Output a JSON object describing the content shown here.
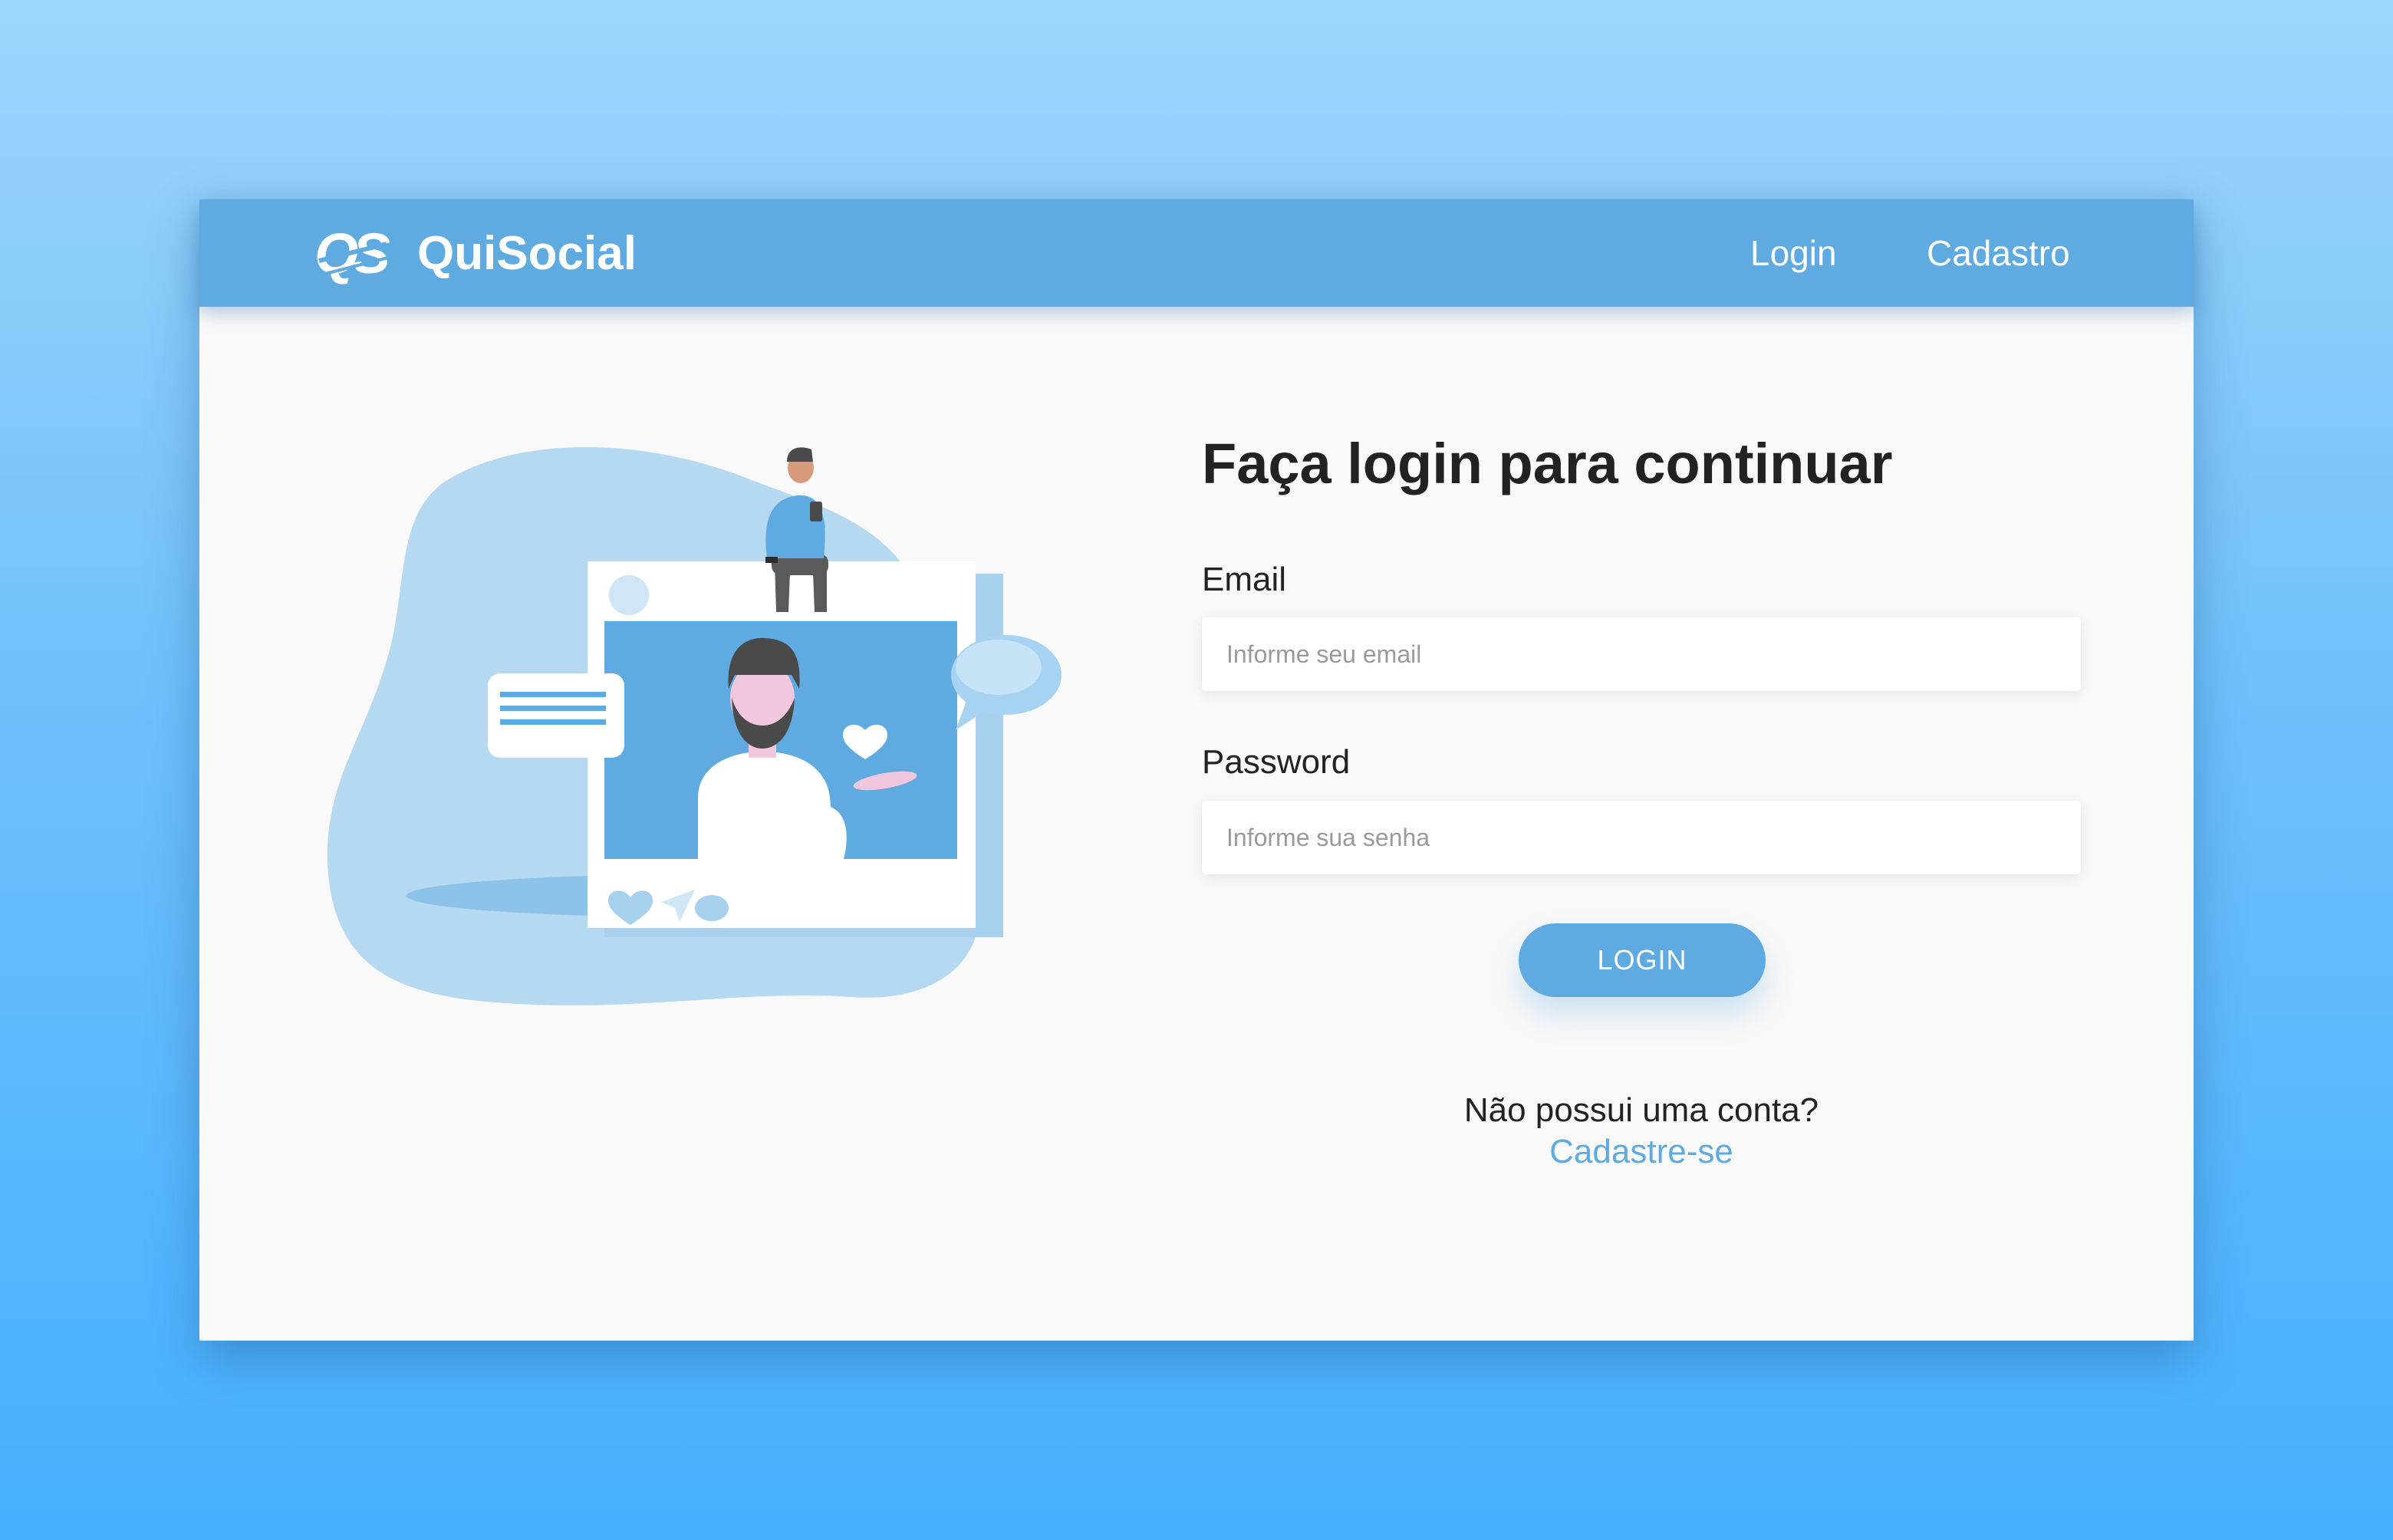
{
  "navbar": {
    "brand": "QuiSocial",
    "logo_text": "QS",
    "links": [
      {
        "label": "Login"
      },
      {
        "label": "Cadastro"
      }
    ]
  },
  "login_form": {
    "heading": "Faça login para continuar",
    "email_label": "Email",
    "email_placeholder": "Informe seu email",
    "email_value": "",
    "password_label": "Password",
    "password_placeholder": "Informe sua senha",
    "password_value": "",
    "submit_label": "LOGIN"
  },
  "signup": {
    "question": "Não possui uma conta?",
    "link": "Cadastre-se"
  },
  "illustration": {
    "icons": [
      "social-media-post-illustration",
      "heart-icon",
      "send-icon",
      "comment-icon",
      "chat-bubble-icon",
      "message-card-icon"
    ]
  },
  "colors": {
    "accent": "#5eaae1",
    "background_top": "#9dd5fb",
    "background_bottom": "#46b0fd",
    "card": "#f9f9f9",
    "text": "#222222"
  }
}
